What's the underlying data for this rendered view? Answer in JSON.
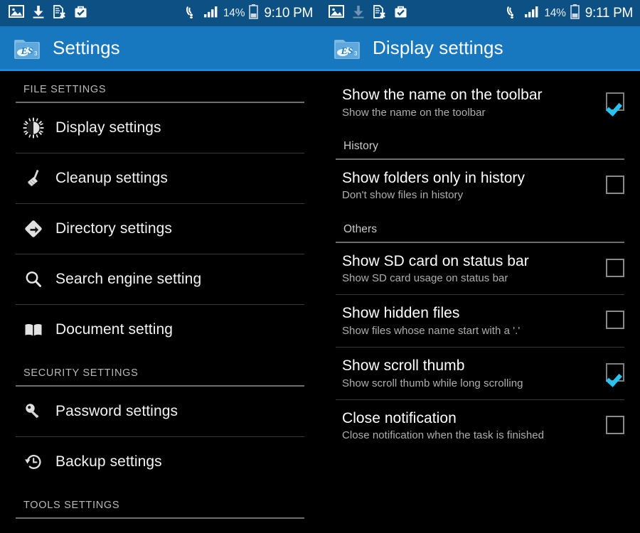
{
  "statusbar": {
    "left_icons": [
      "image-icon",
      "download-icon",
      "document-remove-icon",
      "briefcase-check-icon"
    ],
    "right_icons": [
      "wifi-icon",
      "cellular-signal-icon",
      "battery-icon"
    ],
    "battery_percent": "14%",
    "time_left": "9:10 PM",
    "time_right": "9:11 PM"
  },
  "left_pane": {
    "header": {
      "title": "Settings",
      "logo": "es-file-explorer-logo"
    },
    "groups": [
      {
        "label": "FILE SETTINGS",
        "items": [
          {
            "label": "Display settings",
            "icon": "brightness-icon"
          },
          {
            "label": "Cleanup settings",
            "icon": "broom-icon"
          },
          {
            "label": "Directory settings",
            "icon": "directory-arrow-icon"
          },
          {
            "label": "Search engine setting",
            "icon": "search-icon"
          },
          {
            "label": "Document setting",
            "icon": "book-icon"
          }
        ]
      },
      {
        "label": "SECURITY SETTINGS",
        "items": [
          {
            "label": "Password settings",
            "icon": "key-icon"
          },
          {
            "label": "Backup settings",
            "icon": "clock-restore-icon"
          }
        ]
      },
      {
        "label": "TOOLS SETTINGS",
        "items": []
      }
    ]
  },
  "right_pane": {
    "header": {
      "title": "Display settings",
      "logo": "es-file-explorer-logo"
    },
    "sections": [
      {
        "label": null,
        "prefs": [
          {
            "title": "Show the name on the toolbar",
            "subtitle": "Show the name on the toolbar",
            "checked": true
          }
        ]
      },
      {
        "label": "History",
        "prefs": [
          {
            "title": "Show folders only in history",
            "subtitle": "Don't show files in history",
            "checked": false
          }
        ]
      },
      {
        "label": "Others",
        "prefs": [
          {
            "title": "Show SD card on status bar",
            "subtitle": "Show SD card usage on status bar",
            "checked": false
          },
          {
            "title": "Show hidden files",
            "subtitle": "Show files whose name start with a '.'",
            "checked": false
          },
          {
            "title": "Show scroll thumb",
            "subtitle": "Show scroll thumb while long scrolling",
            "checked": true
          },
          {
            "title": "Close notification",
            "subtitle": "Close notification when the task is finished",
            "checked": false
          }
        ]
      }
    ]
  },
  "colors": {
    "statusbar_bg": "#0d5083",
    "appbar_bg": "#1777bf",
    "appbar_accent": "#1e8ade",
    "background": "#000000",
    "check_accent": "#29c3f2",
    "divider": "#3a3a3a",
    "divider_strong": "#6d6d6d"
  }
}
